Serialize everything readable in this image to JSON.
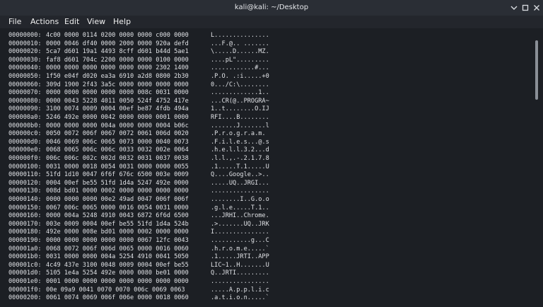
{
  "window": {
    "title": "kali@kali: ~/Desktop"
  },
  "menu": {
    "file": "File",
    "actions": "Actions",
    "edit": "Edit",
    "view": "View",
    "help": "Help"
  },
  "colors": {
    "background": "#1c1f24",
    "text": "#dfe1e5",
    "titlebar": "#2a2e35"
  },
  "icons": {
    "minimize": "minimize-icon",
    "maximize": "maximize-icon",
    "close": "close-icon"
  },
  "hexdump": [
    {
      "offset": "00000000:",
      "hex": "4c00 0000 0114 0200 0000 0000 c000 0000",
      "ascii": "L..............."
    },
    {
      "offset": "00000010:",
      "hex": "0000 0046 df40 0000 2000 0000 920a defd",
      "ascii": "...F.@.. ......."
    },
    {
      "offset": "00000020:",
      "hex": "5ca7 d601 19a1 4493 8cff d601 b44d 5ae1",
      "ascii": "\\.....D......MZ."
    },
    {
      "offset": "00000030:",
      "hex": "faf8 d601 704c 2200 0000 0000 0100 0000",
      "ascii": "....pL\"........."
    },
    {
      "offset": "00000040:",
      "hex": "0000 0000 0000 0000 0000 0000 2302 1400",
      "ascii": "............#..."
    },
    {
      "offset": "00000050:",
      "hex": "1f50 e04f d020 ea3a 6910 a2d8 0800 2b30",
      "ascii": ".P.O. .:i.....+0"
    },
    {
      "offset": "00000060:",
      "hex": "309d 1900 2f43 3a5c 0000 0000 0000 0000",
      "ascii": "0.../C:\\........"
    },
    {
      "offset": "00000070:",
      "hex": "0000 0000 0000 0000 0000 008c 0031 0000",
      "ascii": ".............1.."
    },
    {
      "offset": "00000080:",
      "hex": "0000 0043 5228 4011 0050 524f 4752 417e",
      "ascii": "...CR(@..PROGRA~"
    },
    {
      "offset": "00000090:",
      "hex": "3100 0074 0009 0004 00ef be87 4fdb 494a",
      "ascii": "1..t........O.IJ"
    },
    {
      "offset": "000000a0:",
      "hex": "5246 492e 0000 0042 0000 0000 0001 0000",
      "ascii": "RFI....B........"
    },
    {
      "offset": "000000b0:",
      "hex": "0000 0000 0000 004a 0000 0000 0004 b06c",
      "ascii": ".......J.......l"
    },
    {
      "offset": "000000c0:",
      "hex": "0050 0072 006f 0067 0072 0061 006d 0020",
      "ascii": ".P.r.o.g.r.a.m. "
    },
    {
      "offset": "000000d0:",
      "hex": "0046 0069 006c 0065 0073 0000 0040 0073",
      "ascii": ".F.i.l.e.s...@.s"
    },
    {
      "offset": "000000e0:",
      "hex": "0068 0065 006c 006c 0033 0032 002e 0064",
      "ascii": ".h.e.l.l.3.2...d"
    },
    {
      "offset": "000000f0:",
      "hex": "006c 006c 002c 002d 0032 0031 0037 0038",
      "ascii": ".l.l.,.-.2.1.7.8"
    },
    {
      "offset": "00000100:",
      "hex": "0031 0000 0018 0054 0031 0000 0000 0055",
      "ascii": ".1.....T.1.....U"
    },
    {
      "offset": "00000110:",
      "hex": "51fd 1d10 0047 6f6f 676c 6500 003e 0009",
      "ascii": "Q....Google..>.."
    },
    {
      "offset": "00000120:",
      "hex": "0004 00ef be55 51fd 1d4a 5247 492e 0000",
      "ascii": ".....UQ..JRGI..."
    },
    {
      "offset": "00000130:",
      "hex": "008d bd01 0000 0002 0000 0000 0000 0000",
      "ascii": "................"
    },
    {
      "offset": "00000140:",
      "hex": "0000 0000 0000 00e2 49ad 0047 006f 006f",
      "ascii": "........I..G.o.o"
    },
    {
      "offset": "00000150:",
      "hex": "0067 006c 0065 0000 0016 0054 0031 0000",
      "ascii": ".g.l.e.....T.1.."
    },
    {
      "offset": "00000160:",
      "hex": "0000 004a 5248 4910 0043 6872 6f6d 6500",
      "ascii": "...JRHI..Chrome."
    },
    {
      "offset": "00000170:",
      "hex": "003e 0009 0004 00ef be55 51fd 1d4a 524b",
      "ascii": ".>.......UQ..JRK"
    },
    {
      "offset": "00000180:",
      "hex": "492e 0000 008e bd01 0000 0002 0000 0000",
      "ascii": "I..............."
    },
    {
      "offset": "00000190:",
      "hex": "0000 0000 0000 0000 0000 0067 12fc 0043",
      "ascii": "...........g...C"
    },
    {
      "offset": "000001a0:",
      "hex": "0068 0072 006f 006d 0065 0000 0016 0060",
      "ascii": ".h.r.o.m.e.....`"
    },
    {
      "offset": "000001b0:",
      "hex": "0031 0000 0000 004a 5254 4910 0041 5050",
      "ascii": ".1.....JRTI..APP"
    },
    {
      "offset": "000001c0:",
      "hex": "4c49 437e 3100 0048 0009 0004 00ef be55",
      "ascii": "LIC~1..H.......U"
    },
    {
      "offset": "000001d0:",
      "hex": "5105 1e4a 5254 492e 0000 0080 be01 0000",
      "ascii": "Q..JRTI........."
    },
    {
      "offset": "000001e0:",
      "hex": "0001 0000 0000 0000 0000 0000 0000 0000",
      "ascii": "................"
    },
    {
      "offset": "000001f0:",
      "hex": "00e 09a9 0041 0070 0070 006c 0069 0063",
      "ascii": ".....A.p.p.l.i.c"
    },
    {
      "offset": "00000200:",
      "hex": "0061 0074 0069 006f 006e 0000 0018 0060",
      "ascii": ".a.t.i.o.n.....`"
    }
  ]
}
